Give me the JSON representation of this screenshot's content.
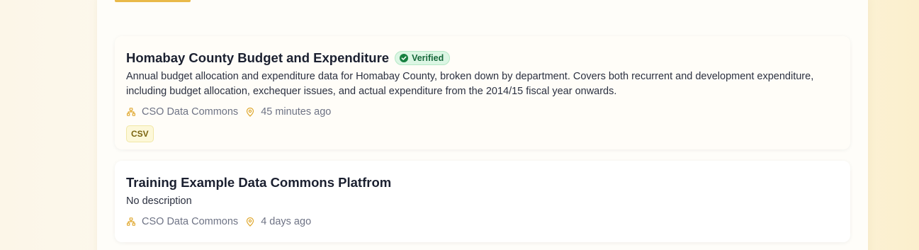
{
  "datasets": [
    {
      "title": "Homabay County Budget and Expenditure",
      "badge": "Verified",
      "description": "Annual budget allocation and expenditure data for Homabay County, broken down by department. Covers both recurrent and development expenditure, including budget allocation, exchequer issues, and actual expenditure from the 2014/15 fiscal year onwards.",
      "publisher": "CSO Data Commons",
      "updated": "45 minutes ago",
      "formats": [
        "CSV"
      ]
    },
    {
      "title": "Training Example Data Commons Platfrom",
      "description": "No description",
      "publisher": "CSO Data Commons",
      "updated": "4 days ago"
    }
  ],
  "colors": {
    "accent": "#e9b949",
    "verified_bg": "#dcf6e4",
    "verified_text": "#16683a",
    "tag_bg": "#fdf8d9"
  },
  "icons": {
    "publisher": "org-hierarchy-icon",
    "time": "location-pin-icon",
    "verified": "check-circle-icon"
  }
}
